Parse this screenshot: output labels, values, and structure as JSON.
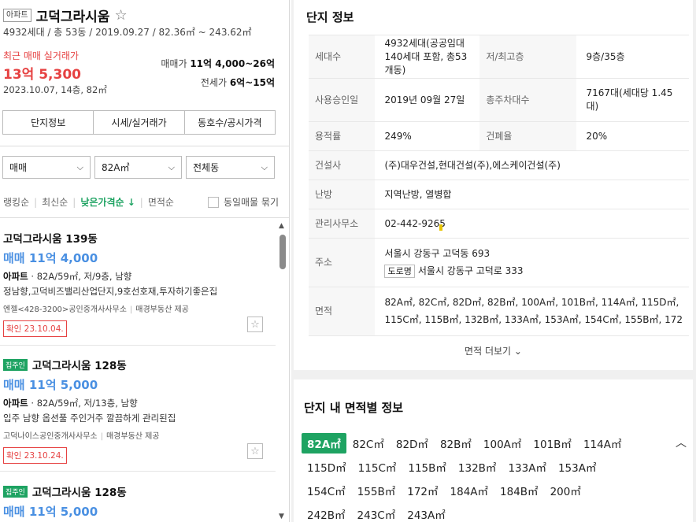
{
  "complex": {
    "type_tag": "아파트",
    "name": "고덕그라시움",
    "meta": "4932세대 / 총 53동 / 2019.09.27 / 82.36㎡ ~ 243.62㎡"
  },
  "recent": {
    "label": "최근 매매 실거래가",
    "price": "13억 5,300",
    "sub": "2023.10.07, 14층, 82㎡",
    "sale_label": "매매가",
    "sale_range": "11억 4,000~26억",
    "jeonse_label": "전세가",
    "jeonse_range": "6억~15억"
  },
  "tabs": [
    "단지정보",
    "시세/실거래가",
    "동호수/공시가격"
  ],
  "filters": {
    "trade": "매매",
    "area": "82A㎡",
    "dong": "전체동"
  },
  "sort": {
    "items": [
      "랭킹순",
      "최신순",
      "낮은가격순 ↓",
      "면적순"
    ],
    "same_group": "동일매물 묶기"
  },
  "listings": [
    {
      "badge": "",
      "title": "고덕그라시움 139동",
      "price": "매매 11억 4,000",
      "spec_type": "아파트",
      "spec": " · 82A/59㎡, 저/9층, 남향",
      "desc": "정남향,고덕비즈밸리산업단지,9호선호재,투자하기좋은집",
      "agent": "엔젤<428-3200>공인중개사사무소",
      "provider": "매경부동산 제공",
      "confirm": "확인 23.10.04."
    },
    {
      "badge": "집주인",
      "title": "고덕그라시움 128동",
      "price": "매매 11억 5,000",
      "spec_type": "아파트",
      "spec": " · 82A/59㎡, 저/13층, 남향",
      "desc": "입주 남향 옵션풀 주인거주 깔끔하게 관리된집",
      "agent": "고덕나이스공인중개사사무소",
      "provider": "매경부동산 제공",
      "confirm": "확인 23.10.24."
    },
    {
      "badge": "집주인",
      "title": "고덕그라시움 128동",
      "price": "매매 11억 5,000"
    }
  ],
  "info": {
    "title": "단지 정보",
    "households_k": "세대수",
    "households_v": "4932세대(공공임대 140세대 포함, 총53개동)",
    "floors_k": "저/최고층",
    "floors_v": "9층/35층",
    "approval_k": "사용승인일",
    "approval_v": "2019년 09월 27일",
    "parking_k": "총주차대수",
    "parking_v": "7167대(세대당 1.45대)",
    "far_k": "용적률",
    "far_v": "249%",
    "bcr_k": "건폐율",
    "bcr_v": "20%",
    "builder_k": "건설사",
    "builder_v": "(주)대우건설,현대건설(주),에스케이건설(주)",
    "heating_k": "난방",
    "heating_v": "지역난방, 열병합",
    "office_k": "관리사무소",
    "office_v": "02-442-9265",
    "address_k": "주소",
    "address_v": "서울시 강동구 고덕동 693",
    "road_tag": "도로명",
    "road_v": "서울시 강동구 고덕로 333",
    "area_k": "면적",
    "area_v1": "82A㎡, 82C㎡, 82D㎡, 82B㎡, 100A㎡, 101B㎡, 114A㎡, 115D㎡,",
    "area_v2": "115C㎡, 115B㎡, 132B㎡, 133A㎡, 153A㎡, 154C㎡, 155B㎡, 172",
    "more": "면적 더보기"
  },
  "area_info": {
    "title": "단지 내 면적별 정보",
    "rows": [
      [
        "82A㎡",
        "82C㎡",
        "82D㎡",
        "82B㎡",
        "100A㎡",
        "101B㎡",
        "114A㎡"
      ],
      [
        "115D㎡",
        "115C㎡",
        "115B㎡",
        "132B㎡",
        "133A㎡",
        "153A㎡"
      ],
      [
        "154C㎡",
        "155B㎡",
        "172㎡",
        "184A㎡",
        "184B㎡",
        "200㎡"
      ],
      [
        "242B㎡",
        "243C㎡",
        "243A㎡"
      ]
    ],
    "selected": "82A㎡"
  },
  "colors": {
    "accent_green": "#1ea362",
    "price_red": "#e64242",
    "price_blue": "#4a90e2"
  },
  "icons": [
    "star-icon",
    "chevron-down-icon",
    "arrow-up-icon",
    "arrow-down-icon",
    "chevron-up-icon"
  ]
}
